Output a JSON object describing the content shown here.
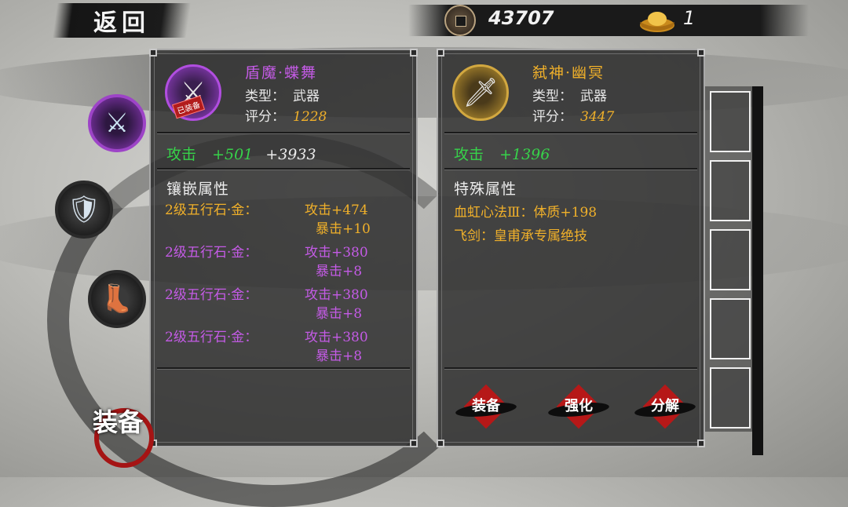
{
  "topbar": {
    "back_label": "返回",
    "coin_value": "43707",
    "ingot_value": "1"
  },
  "left_panel": {
    "item_name": "盾魔·蝶舞",
    "item_name_color": "#c45be6",
    "type_label": "类型：",
    "type_value": "武器",
    "score_label": "评分：",
    "score_value": "1228",
    "stamp_label": "已装备",
    "attack_label": "攻击",
    "attack_bonus": "+501",
    "attack_total": "+3933",
    "section_title": "镶嵌属性",
    "gems": [
      {
        "name": "2级五行石·金：",
        "stat1": "攻击+474",
        "stat2": "暴击+10",
        "color": "#f0b02a"
      },
      {
        "name": "2级五行石·金：",
        "stat1": "攻击+380",
        "stat2": "暴击+8",
        "color": "#c45be6"
      },
      {
        "name": "2级五行石·金：",
        "stat1": "攻击+380",
        "stat2": "暴击+8",
        "color": "#c45be6"
      },
      {
        "name": "2级五行石·金：",
        "stat1": "攻击+380",
        "stat2": "暴击+8",
        "color": "#c45be6"
      }
    ]
  },
  "right_panel": {
    "item_name": "弑神·幽冥",
    "item_name_color": "#f0b02a",
    "type_label": "类型：",
    "type_value": "武器",
    "score_label": "评分：",
    "score_value": "3447",
    "attack_label": "攻击",
    "attack_bonus": "+1396",
    "section_title": "特殊属性",
    "specials": [
      "血虹心法Ⅲ：体质+198",
      "飞剑：皇甫承专属绝技"
    ],
    "buttons": {
      "equip": "装备",
      "enhance": "强化",
      "decompose": "分解"
    }
  },
  "bottom": {
    "equip_tab_label": "装备"
  },
  "icons": {
    "coin": "copper-coin-icon",
    "ingot": "gold-ingot-icon"
  }
}
